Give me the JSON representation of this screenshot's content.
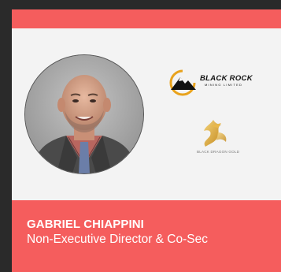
{
  "profile": {
    "name": "GABRIEL CHIAPPINI",
    "role": "Non-Executive Director & Co-Sec"
  },
  "logos": {
    "blackrock": {
      "name": "BLACK ROCK",
      "subtitle": "MINING LIMITED"
    },
    "dragon": {
      "name": "BLACK DRAGON GOLD"
    }
  },
  "colors": {
    "accent": "#f55d5d",
    "card_background": "#f3f3f3",
    "page_background": "#2a2a2a",
    "text_on_accent": "#ffffff"
  },
  "icons": {
    "blackrock_logo": "mountain-sun-logo",
    "dragon_logo": "gold-dragon-logo"
  }
}
